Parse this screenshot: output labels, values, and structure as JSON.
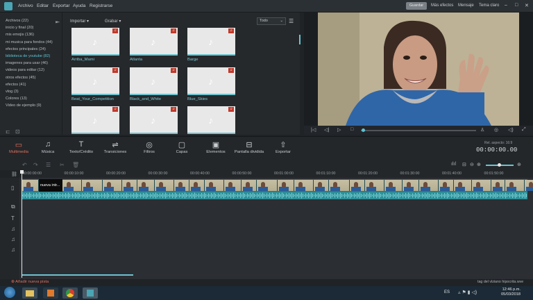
{
  "menubar": {
    "items": [
      "Archivo",
      "Editar",
      "Exportar",
      "Ayuda",
      "Registrarse"
    ],
    "right": {
      "save": "Guardar",
      "more_effects": "Más efectos",
      "message": "Mensaje",
      "theme": "Tema claro"
    }
  },
  "library": {
    "folders": [
      {
        "label": "Archivos (22)",
        "active": false
      },
      {
        "label": "inicio y final (20)",
        "active": false
      },
      {
        "label": "mis emojis (136)",
        "active": false
      },
      {
        "label": "mi musica para fondos (44)",
        "active": false
      },
      {
        "label": "efectos principales (24)",
        "active": false
      },
      {
        "label": "biblioteca de youtube (82)",
        "active": true
      },
      {
        "label": "imagenes para usar (46)",
        "active": false
      },
      {
        "label": "videos para editar (12)",
        "active": false
      },
      {
        "label": "otros efectos (45)",
        "active": false
      },
      {
        "label": "efectos (41)",
        "active": false
      },
      {
        "label": "vlog (3)",
        "active": false
      },
      {
        "label": "Colores (13)",
        "active": false
      },
      {
        "label": "Video de ejemplo (9)",
        "active": false
      }
    ],
    "import_label": "Importar",
    "record_label": "Grabar",
    "filter_value": "Todo",
    "items": [
      "Arriba_Mami",
      "Atlanta",
      "Barge",
      "Beat_Your_Competition",
      "Black_and_White",
      "Blue_Skies",
      "",
      "",
      ""
    ]
  },
  "toolbar": {
    "items": [
      {
        "label": "Multimedia",
        "icon": "folder-icon",
        "active": true
      },
      {
        "label": "Música",
        "icon": "music-icon",
        "active": false
      },
      {
        "label": "Texto/Crédito",
        "icon": "text-icon",
        "active": false
      },
      {
        "label": "Transiciones",
        "icon": "transition-icon",
        "active": false
      },
      {
        "label": "Filtros",
        "icon": "filter-icon",
        "active": false
      },
      {
        "label": "Capas",
        "icon": "layers-icon",
        "active": false
      },
      {
        "label": "Elementos",
        "icon": "elements-icon",
        "active": false
      },
      {
        "label": "Pantalla dividida",
        "icon": "split-screen-icon",
        "active": false
      },
      {
        "label": "Exportar",
        "icon": "export-icon",
        "active": false
      }
    ],
    "aspect": "Rel. aspecto: 16:9",
    "timecode": "00:00:00.00"
  },
  "timeline": {
    "ticks": [
      "00:00:00:00",
      "00:00:10:00",
      "00:00:20:00",
      "00:00:30:00",
      "00:00:40:00",
      "00:00:50:00",
      "00:01:00:00",
      "00:01:10:00",
      "00:01:20:00",
      "00:01:30:00",
      "00:01:40:00",
      "00:01:50:00"
    ],
    "black_clip_label": "nueva intr...",
    "add_track": "Añadir nueva pista",
    "status": "tag del vlziano hipocrita.wve"
  },
  "taskbar": {
    "lang": "ES",
    "time": "12:46 p.m.",
    "date": "05/03/2018"
  },
  "colors": {
    "accent": "#5ec4d4",
    "active_tab": "#e46f5e",
    "clip": "#2d8f97"
  }
}
